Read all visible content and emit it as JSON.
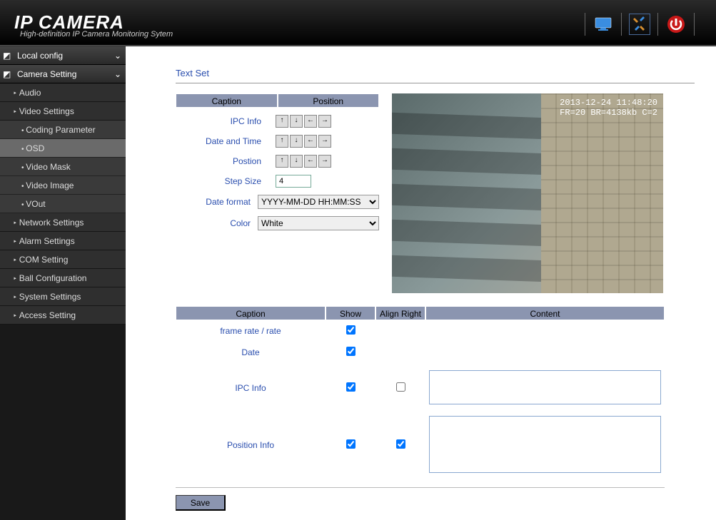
{
  "header": {
    "title": "IP CAMERA",
    "subtitle": "High-definition IP Camera Monitoring Sytem"
  },
  "sidebar": {
    "local_config": "Local config",
    "camera_setting": "Camera Setting",
    "audio": "Audio",
    "video_settings": "Video Settings",
    "coding_parameter": "Coding Parameter",
    "osd": "OSD",
    "video_mask": "Video Mask",
    "video_image": "Video Image",
    "vout": "VOut",
    "network_settings": "Network Settings",
    "alarm_settings": "Alarm Settings",
    "com_setting": "COM Setting",
    "ball_configuration": "Ball Configuration",
    "system_settings": "System Settings",
    "access_setting": "Access Setting"
  },
  "main": {
    "title": "Text Set",
    "th_caption": "Caption",
    "th_position": "Position",
    "rows": {
      "ipc_info": "IPC Info",
      "date_time": "Date and Time",
      "position": "Postion",
      "step_size": "Step Size",
      "date_format": "Date format",
      "color": "Color"
    },
    "step_value": "4",
    "date_format_value": "YYYY-MM-DD HH:MM:SS",
    "color_value": "White",
    "preview_overlay": "2013-12-24 11:48:20\nFR=20 BR=4138kb C=2",
    "table2": {
      "caption": "Caption",
      "show": "Show",
      "align_right": "Align Right",
      "content": "Content",
      "frame_rate": "frame rate / rate",
      "date": "Date",
      "ipc_info": "IPC Info",
      "position_info": "Position Info",
      "ipc_content": "",
      "pos_content": ""
    },
    "save": "Save"
  }
}
